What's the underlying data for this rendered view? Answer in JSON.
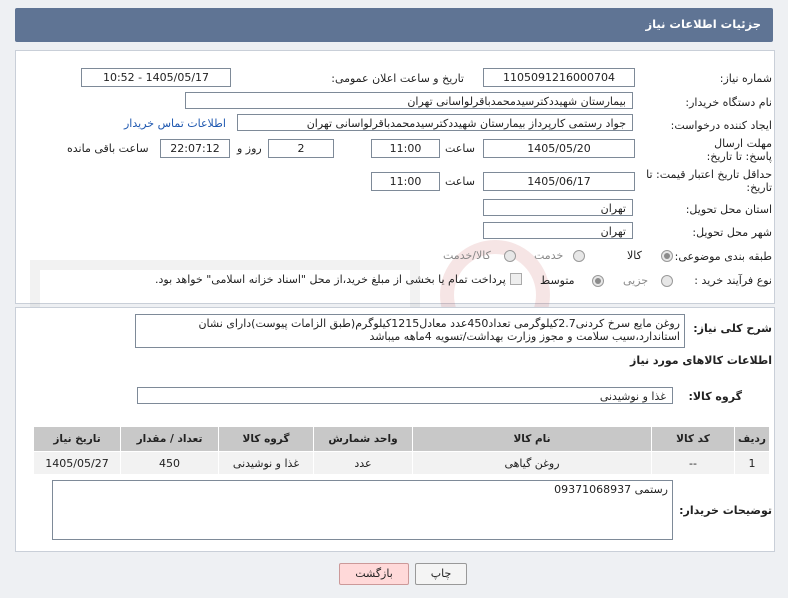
{
  "header": {
    "title": "جزئیات اطلاعات نیاز"
  },
  "form": {
    "need_number_label": "شماره نیاز:",
    "need_number": "1105091216000704",
    "announce_datetime_label": "تاریخ و ساعت اعلان عمومی:",
    "announce_datetime": "1405/05/17 - 10:52",
    "buyer_org_label": "نام دستگاه خریدار:",
    "buyer_org": "بیمارستان شهیددکترسیدمحمدباقرلواسانی تهران",
    "requester_label": "ایجاد کننده درخواست:",
    "requester": "جواد رستمی کارپرداز بیمارستان شهیددکترسیدمحمدباقرلواسانی تهران",
    "buyer_contact_link": "اطلاعات تماس خریدار",
    "reply_deadline_label": "مهلت ارسال پاسخ: تا تاریخ:",
    "reply_date": "1405/05/20",
    "time_label": "ساعت",
    "reply_time": "11:00",
    "days_value": "2",
    "days_and_label": "روز و",
    "remaining_time": "22:07:12",
    "remaining_label": "ساعت باقی مانده",
    "price_validity_label": "حداقل تاریخ اعتبار قیمت: تا تاریخ:",
    "price_date": "1405/06/17",
    "price_time": "11:00",
    "delivery_province_label": "استان محل تحویل:",
    "delivery_province": "تهران",
    "delivery_city_label": "شهر محل تحویل:",
    "delivery_city": "تهران",
    "category_label": "طبقه بندی موضوعی:",
    "category_options": [
      "کالا",
      "خدمت",
      "کالا/خدمت"
    ],
    "purchase_process_label": "نوع فرآیند خرید :",
    "purchase_options": [
      "جزیی",
      "متوسط"
    ],
    "payment_note": "پرداخت تمام یا بخشی از مبلغ خرید،از محل \"اسناد خزانه اسلامی\" خواهد بود."
  },
  "description": {
    "label": "شرح کلی نیاز:",
    "text": "روغن مایع سرخ کردنی2.7کیلوگرمی تعداد450عدد معادل1215کیلوگرم(طبق الزامات پیوست)دارای نشان استاندارد،سیب سلامت و مجوز وزارت بهداشت/تسویه 4ماهه میباشد"
  },
  "goods": {
    "section_title": "اطلاعات کالاهای مورد نیاز",
    "group_label": "گروه کالا:",
    "group_value": "غذا و نوشیدنی",
    "columns": [
      "ردیف",
      "کد کالا",
      "نام کالا",
      "واحد شمارش",
      "گروه کالا",
      "تعداد / مقدار",
      "تاریخ نیاز"
    ],
    "rows": [
      [
        "1",
        "--",
        "روغن گیاهی",
        "عدد",
        "غذا و نوشیدنی",
        "450",
        "1405/05/27"
      ]
    ]
  },
  "buyer_notes": {
    "label": "توضیحات خریدار:",
    "text": "رستمی 09371068937"
  },
  "buttons": {
    "print": "چاپ",
    "back": "بازگشت"
  },
  "colors": {
    "header": "#5f7494",
    "link": "#1f58b0",
    "back_button": "#ffd9d9"
  }
}
